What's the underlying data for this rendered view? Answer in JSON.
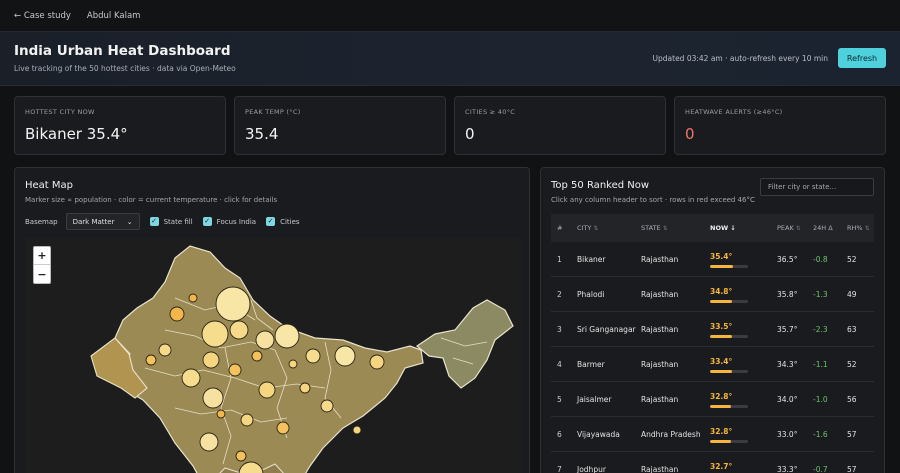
{
  "nav": {
    "back": "← Case study",
    "author": "Abdul Kalam"
  },
  "header": {
    "title": "India Urban Heat Dashboard",
    "subtitle": "Live tracking of the 50 hottest cities · data via Open-Meteo",
    "updated": "Updated 03:42 am · auto-refresh every 10 min",
    "refresh": "Refresh"
  },
  "kpis": [
    {
      "label": "Hottest city now",
      "value": "Bikaner 35.4°"
    },
    {
      "label": "Peak temp (°C)",
      "value": "35.4"
    },
    {
      "label": "Cities ≥ 40°C",
      "value": "0"
    },
    {
      "label": "Heatwave alerts (≥46°C)",
      "value": "0"
    }
  ],
  "map": {
    "title": "Heat Map",
    "description": "Marker size ∝ population · color = current temperature · click for details",
    "basemap_label": "Basemap",
    "basemap_value": "Dark Matter",
    "toggles": [
      {
        "label": "State fill",
        "checked": true
      },
      {
        "label": "Focus India",
        "checked": true
      },
      {
        "label": "Cities",
        "checked": true
      }
    ],
    "zoom_in": "+",
    "zoom_out": "−"
  },
  "table": {
    "title": "Top 50 Ranked Now",
    "description": "Click any column header to sort · rows in red exceed 46°C",
    "filter_placeholder": "Filter city or state...",
    "headers": {
      "rank": "#",
      "city": "City",
      "state": "State",
      "now": "Now ↓",
      "peak": "Peak",
      "delta": "24h Δ",
      "rh": "RH%"
    },
    "rows": [
      {
        "rank": "1",
        "city": "Bikaner",
        "state": "Rajasthan",
        "now": "35.4°",
        "now_value": 35.4,
        "peak": "36.5°",
        "delta": "-0.8",
        "rh": "52"
      },
      {
        "rank": "2",
        "city": "Phalodi",
        "state": "Rajasthan",
        "now": "34.8°",
        "now_value": 34.8,
        "peak": "35.8°",
        "delta": "-1.3",
        "rh": "49"
      },
      {
        "rank": "3",
        "city": "Sri Ganganagar",
        "state": "Rajasthan",
        "now": "33.5°",
        "now_value": 33.5,
        "peak": "35.7°",
        "delta": "-2.3",
        "rh": "63"
      },
      {
        "rank": "4",
        "city": "Barmer",
        "state": "Rajasthan",
        "now": "33.4°",
        "now_value": 33.4,
        "peak": "34.3°",
        "delta": "-1.1",
        "rh": "52"
      },
      {
        "rank": "5",
        "city": "Jaisalmer",
        "state": "Rajasthan",
        "now": "32.8°",
        "now_value": 32.8,
        "peak": "34.0°",
        "delta": "-1.0",
        "rh": "56"
      },
      {
        "rank": "6",
        "city": "Vijayawada",
        "state": "Andhra Pradesh",
        "now": "32.8°",
        "now_value": 32.8,
        "peak": "33.0°",
        "delta": "-1.6",
        "rh": "57"
      },
      {
        "rank": "7",
        "city": "Jodhpur",
        "state": "Rajasthan",
        "now": "32.7°",
        "now_value": 32.7,
        "peak": "33.3°",
        "delta": "-0.7",
        "rh": "57"
      }
    ]
  },
  "colors": {
    "accent": "#4fd1dd",
    "temp": "#f5b63e",
    "alert": "#f1756a",
    "delta_down": "#6cc46c"
  }
}
